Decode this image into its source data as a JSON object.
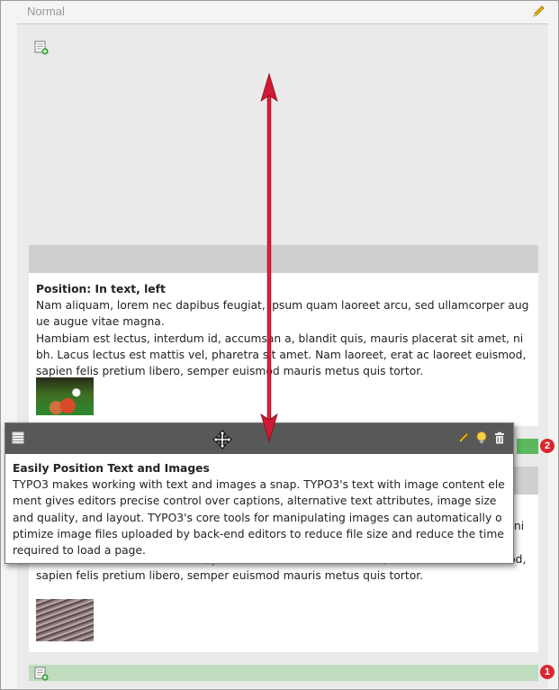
{
  "header": {
    "column_label": "Normal"
  },
  "element1": {
    "title": "Position: In text, left",
    "paragraph1": "Nam aliquam, lorem nec dapibus feugiat, ipsum quam laoreet arcu, sed ullamcorper augue augue vitae magna.",
    "paragraph2": "Hambiam est lectus, interdum id, accumsan a, blandit quis, mauris placerat sit amet, nibh. Lacus lectus est mattis vel, pharetra sit amet. Nam laoreet, erat ac laoreet euismod, sapien felis pretium libero, semper euismod mauris metus quis tortor."
  },
  "element2": {
    "fragment": "ni",
    "text": "bh. Lacus lectus est mattis vel, pharetra sit amet. Nam laoreet, erat ac laoreet euismod, sapien felis pretium libero, semper euismod mauris metus quis tortor."
  },
  "drag_preview": {
    "title": "Easily Position Text and Images",
    "body": "TYPO3 makes working with text and images a snap. TYPO3's text with image content element gives editors precise control over captions, alternative text attributes, image size and quality, and layout. TYPO3's core tools for manipulating images can automatically optimize image files uploaded by back-end editors to reduce file size and reduce the time required to load a page."
  },
  "badges": {
    "first": "1",
    "second": "2"
  },
  "colors": {
    "drop_zone_active": "#5cb85c",
    "drop_zone_idle": "#bfdcbf",
    "badge": "#d9272e",
    "arrow": "#c8102e",
    "drag_header": "#585858"
  },
  "icons": [
    "pencil-icon",
    "new-content-icon",
    "table-icon",
    "move-icon",
    "bulb-icon",
    "trash-icon"
  ]
}
